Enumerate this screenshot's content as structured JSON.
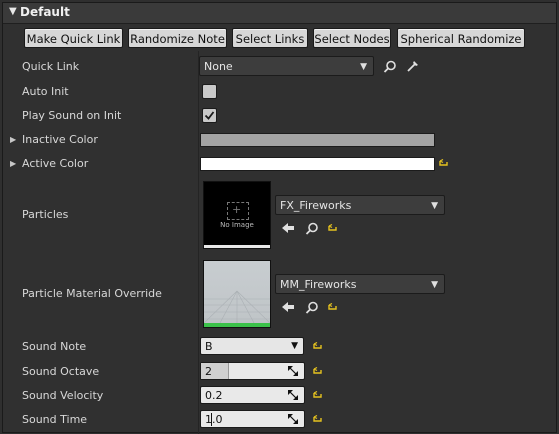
{
  "section": {
    "title": "Default"
  },
  "buttons": [
    {
      "label": "Make Quick Link"
    },
    {
      "label": "Randomize Note"
    },
    {
      "label": "Select Links"
    },
    {
      "label": "Select Nodes"
    },
    {
      "label": "Spherical Randomize"
    }
  ],
  "properties": {
    "quick_link": {
      "label": "Quick Link",
      "value": "None"
    },
    "auto_init": {
      "label": "Auto Init",
      "checked": false
    },
    "play_sound_on_init": {
      "label": "Play Sound on Init",
      "checked": true
    },
    "inactive_color": {
      "label": "Inactive Color",
      "color": "#a3a3a3"
    },
    "active_color": {
      "label": "Active Color",
      "color": "#ffffff"
    },
    "particles": {
      "label": "Particles",
      "asset": "FX_Fireworks",
      "thumbnail_text": "No Image"
    },
    "particle_material_override": {
      "label": "Particle Material Override",
      "asset": "MM_Fireworks"
    },
    "sound_note": {
      "label": "Sound Note",
      "value": "B"
    },
    "sound_octave": {
      "label": "Sound Octave",
      "value": "2"
    },
    "sound_velocity": {
      "label": "Sound Velocity",
      "value": "0.2"
    },
    "sound_time": {
      "label": "Sound Time",
      "value": "1.0"
    }
  },
  "icons": {
    "expand": "triangle-down-icon",
    "collapsed": "triangle-right-icon",
    "browse": "magnifier-icon",
    "picker": "eyedropper-icon",
    "use_selected": "arrow-left-icon",
    "reset": "reset-to-default-icon",
    "drag": "drag-arrows-icon"
  },
  "colors": {
    "reset_icon": "#e5c21f",
    "accent_green": "#3bc24a"
  }
}
